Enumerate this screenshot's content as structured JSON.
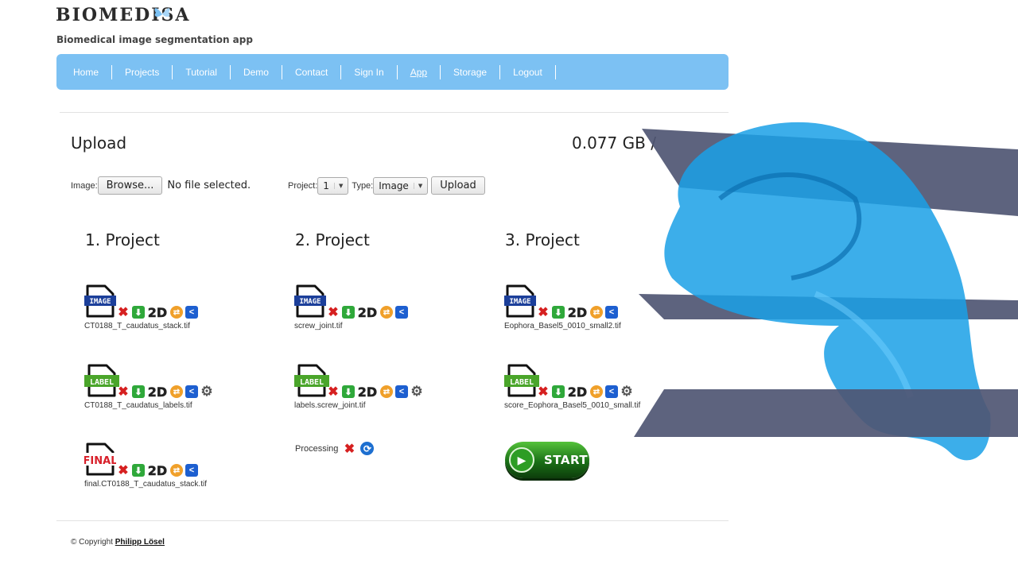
{
  "logo": {
    "text": "BIOMEDISA",
    "subtitle": "Biomedical image segmentation app"
  },
  "nav": {
    "items": [
      "Home",
      "Projects",
      "Tutorial",
      "Demo",
      "Contact",
      "Sign In",
      "App",
      "Storage",
      "Logout"
    ],
    "active": "App"
  },
  "upload": {
    "title": "Upload",
    "storage": "0.077 GB /",
    "image_label": "Image:",
    "browse_label": "Browse...",
    "no_file": "No file selected.",
    "project_label": "Project:",
    "project_value": "1",
    "type_label": "Type:",
    "type_value": "Image",
    "upload_button": "Upload"
  },
  "projects": [
    {
      "title": "1. Project",
      "image": {
        "badge": "IMAGE",
        "filename": "CT0188_T_caudatus_stack.tif"
      },
      "label": {
        "badge": "LABEL",
        "filename": "CT0188_T_caudatus_labels.tif"
      },
      "final": {
        "badge": "FINAL",
        "filename": "final.CT0188_T_caudatus_stack.tif"
      }
    },
    {
      "title": "2. Project",
      "image": {
        "badge": "IMAGE",
        "filename": "screw_joint.tif"
      },
      "label": {
        "badge": "LABEL",
        "filename": "labels.screw_joint.tif"
      },
      "status": "Processing"
    },
    {
      "title": "3. Project",
      "image": {
        "badge": "IMAGE",
        "filename": "Eophora_Basel5_0010_small2.tif"
      },
      "label": {
        "badge": "LABEL",
        "filename": "score_Eophora_Basel5_0010_small.tif"
      },
      "start_label": "START"
    }
  ],
  "tool_labels": {
    "two_d": "2D"
  },
  "footer": {
    "prefix": "© Copyright",
    "author": "Philipp Lösel"
  },
  "colors": {
    "navbar": "#7cc1f3",
    "image_badge": "#1c3f9a",
    "label_badge": "#4aa52a",
    "final_badge": "#d8202a"
  }
}
